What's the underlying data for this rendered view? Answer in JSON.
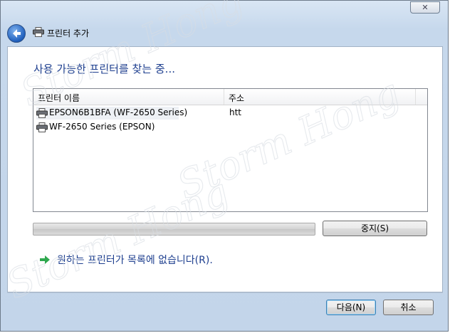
{
  "window": {
    "close_glyph": "✕",
    "title": "프린터 추가"
  },
  "main": {
    "heading": "사용 가능한 프린터를 찾는 중...",
    "list": {
      "columns": [
        "프린터 이름",
        "주소"
      ],
      "rows": [
        {
          "name": "EPSON6B1BFA (WF-2650 Series)",
          "address": "htt"
        },
        {
          "name": "WF-2650 Series (EPSON)",
          "address": ""
        }
      ]
    },
    "stop_button": "중지(S)",
    "not_listed_link": "원하는 프린터가 목록에 없습니다(R)."
  },
  "footer": {
    "next_button": "다음(N)",
    "cancel_button": "취소"
  },
  "watermark": {
    "text": "Storm Hong"
  },
  "colors": {
    "accent": "#1e3f8f",
    "frame": "#c6d8ec",
    "arrow": "#2fa84f"
  }
}
